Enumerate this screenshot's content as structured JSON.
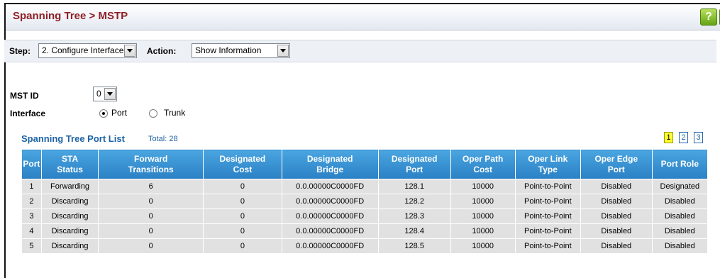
{
  "page": {
    "title": "Spanning Tree > MSTP"
  },
  "header": {
    "help_icon": "question-mark-icon",
    "help_label": "?"
  },
  "stepbar": {
    "step_label": "Step:",
    "step_value": "2. Configure Interface",
    "action_label": "Action:",
    "action_value": "Show Information"
  },
  "form": {
    "mst_id_label": "MST ID",
    "mst_id_value": "0",
    "interface_label": "Interface",
    "interface_options": [
      {
        "label": "Port",
        "selected": true
      },
      {
        "label": "Trunk",
        "selected": false
      }
    ]
  },
  "port_list": {
    "title": "Spanning Tree Port List",
    "total": "Total: 28",
    "pages": [
      {
        "label": "1",
        "current": true
      },
      {
        "label": "2",
        "current": false
      },
      {
        "label": "3",
        "current": false
      }
    ],
    "columns": [
      [
        "Port"
      ],
      [
        "STA",
        "Status"
      ],
      [
        "Forward",
        "Transitions"
      ],
      [
        "Designated",
        "Cost"
      ],
      [
        "Designated",
        "Bridge"
      ],
      [
        "Designated",
        "Port"
      ],
      [
        "Oper Path",
        "Cost"
      ],
      [
        "Oper Link",
        "Type"
      ],
      [
        "Oper Edge",
        "Port"
      ],
      [
        "Port Role"
      ]
    ],
    "rows": [
      [
        "1",
        "Forwarding",
        "6",
        "0",
        "0.0.00000C0000FD",
        "128.1",
        "10000",
        "Point-to-Point",
        "Disabled",
        "Designated"
      ],
      [
        "2",
        "Discarding",
        "0",
        "0",
        "0.0.00000C0000FD",
        "128.2",
        "10000",
        "Point-to-Point",
        "Disabled",
        "Disabled"
      ],
      [
        "3",
        "Discarding",
        "0",
        "0",
        "0.0.00000C0000FD",
        "128.3",
        "10000",
        "Point-to-Point",
        "Disabled",
        "Disabled"
      ],
      [
        "4",
        "Discarding",
        "0",
        "0",
        "0.0.00000C0000FD",
        "128.4",
        "10000",
        "Point-to-Point",
        "Disabled",
        "Disabled"
      ],
      [
        "5",
        "Discarding",
        "0",
        "0",
        "0.0.00000C0000FD",
        "128.5",
        "10000",
        "Point-to-Point",
        "Disabled",
        "Disabled"
      ]
    ]
  }
}
